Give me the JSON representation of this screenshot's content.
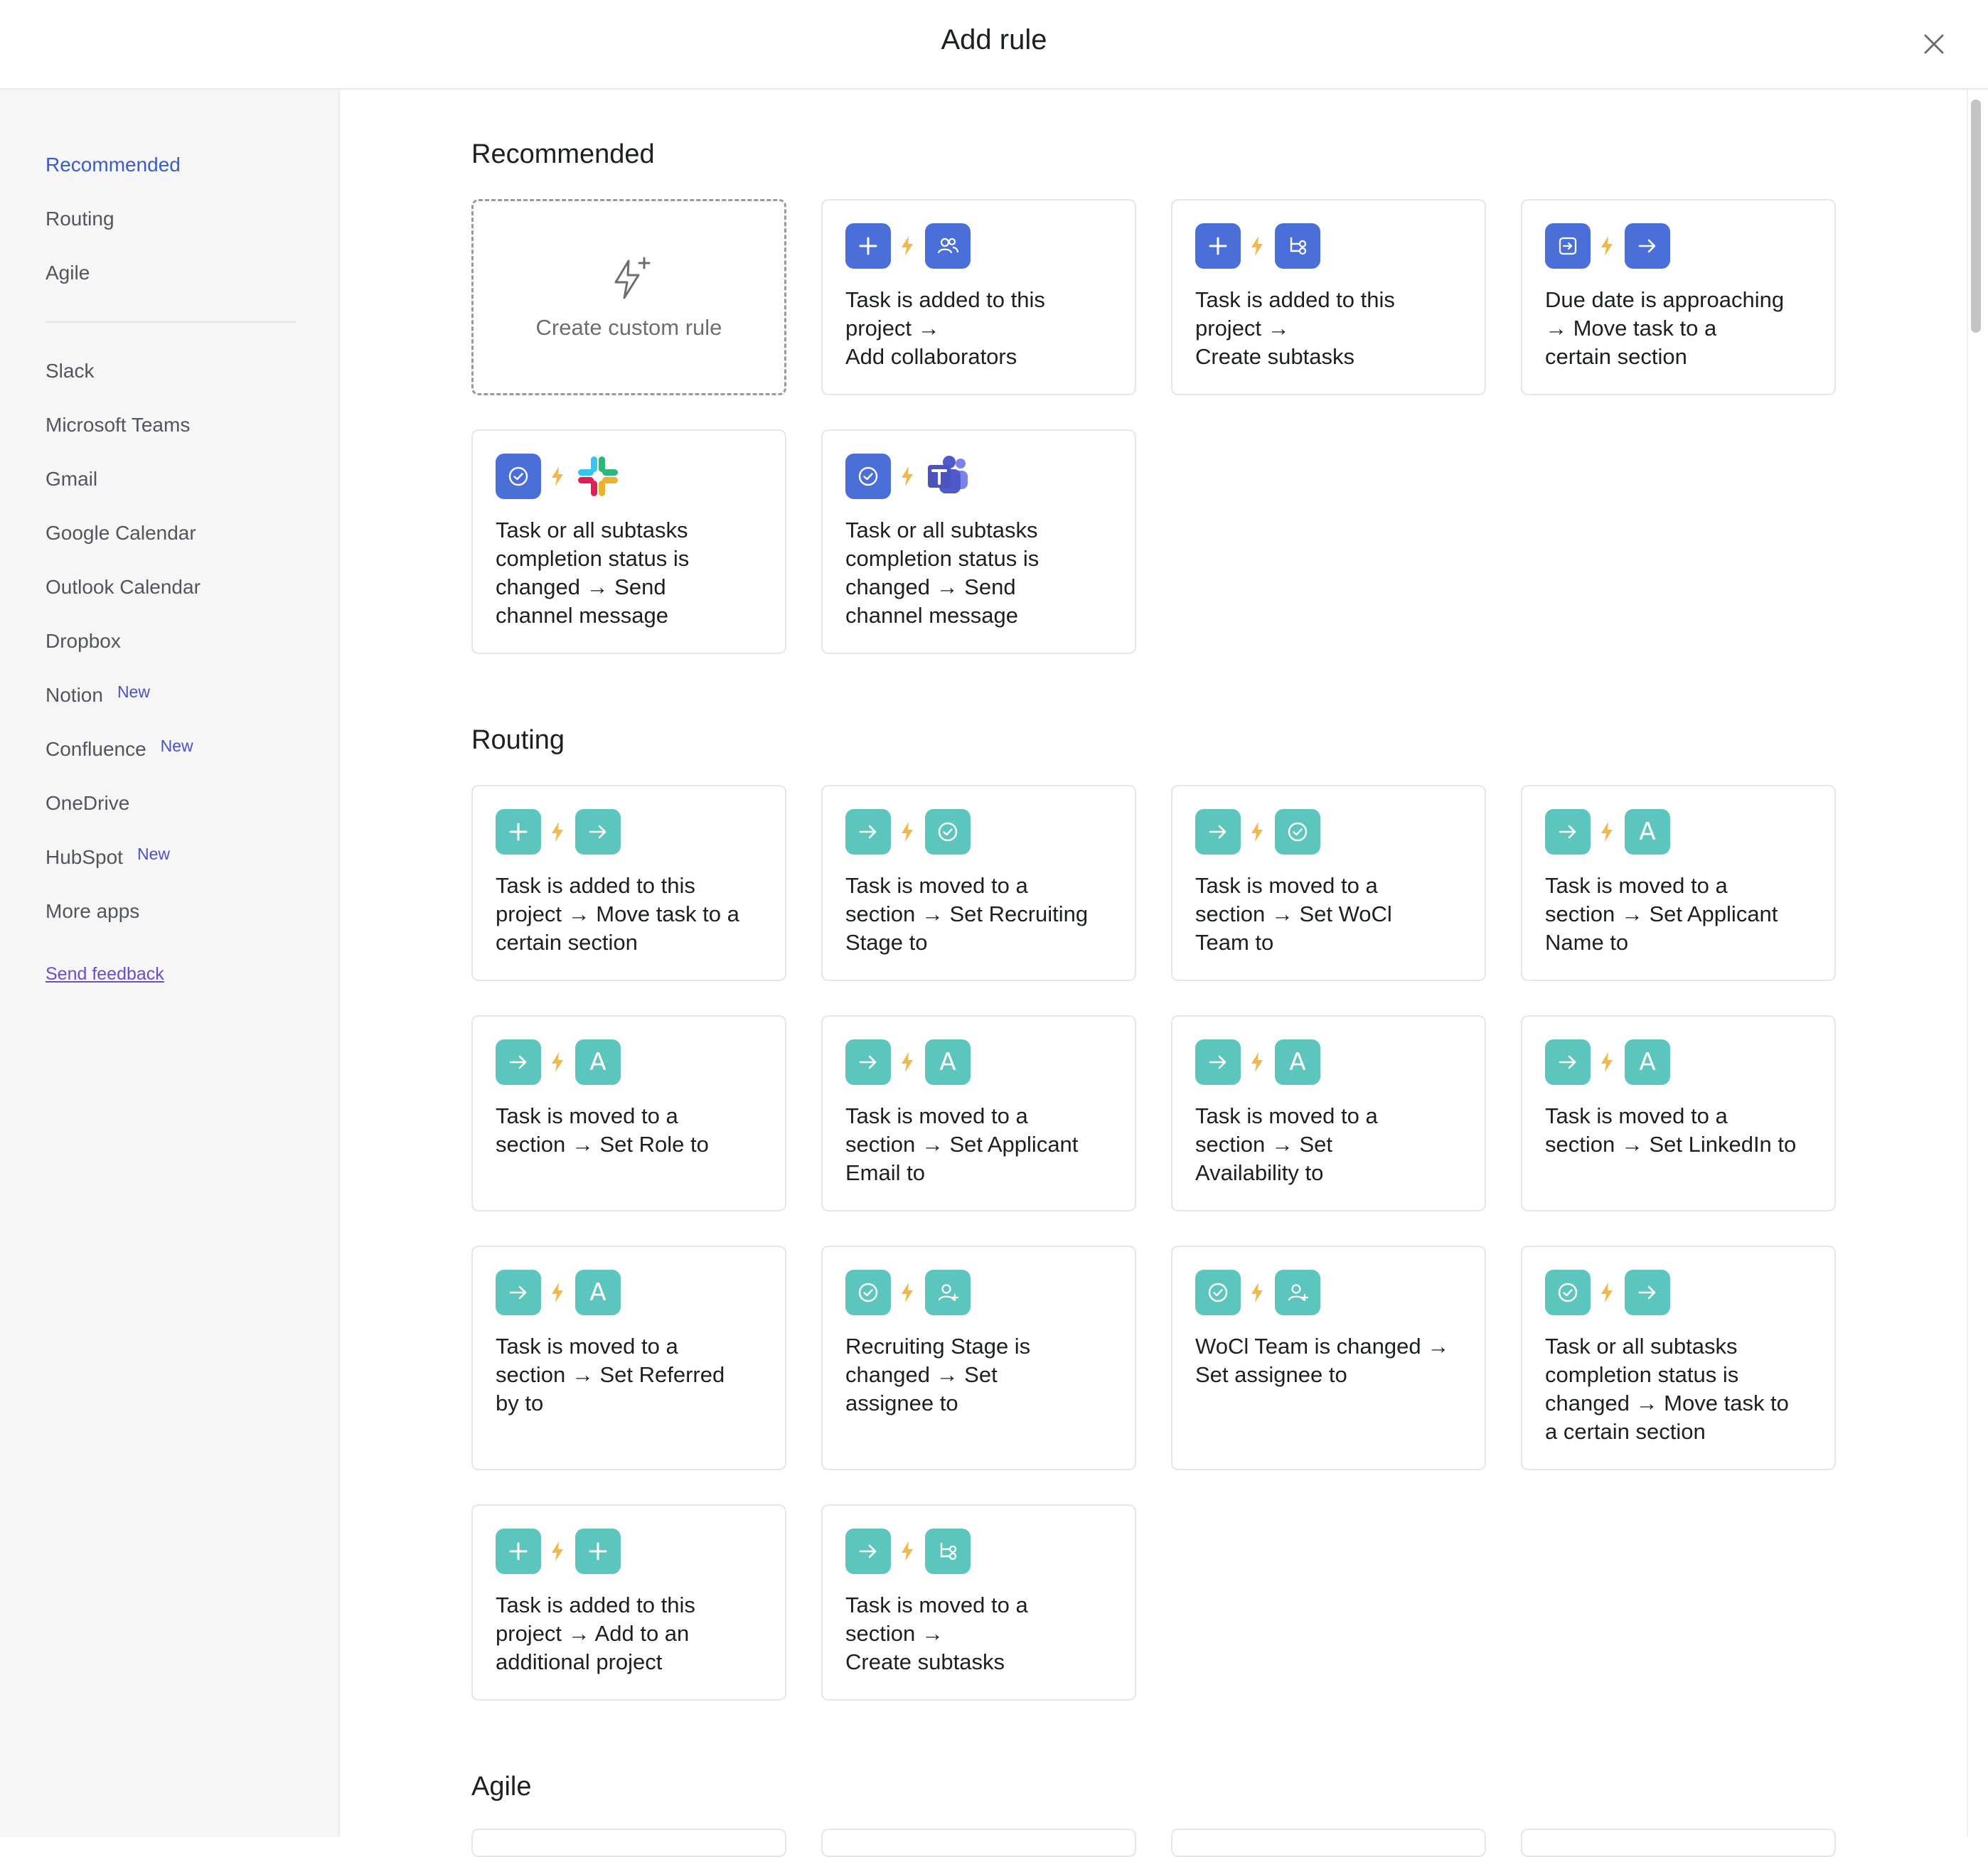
{
  "header": {
    "title": "Add rule"
  },
  "sidebar": {
    "items": [
      {
        "label": "Recommended",
        "badge": ""
      },
      {
        "label": "Routing",
        "badge": ""
      },
      {
        "label": "Agile",
        "badge": ""
      },
      {
        "label": "Slack",
        "badge": ""
      },
      {
        "label": "Microsoft Teams",
        "badge": ""
      },
      {
        "label": "Gmail",
        "badge": ""
      },
      {
        "label": "Google Calendar",
        "badge": ""
      },
      {
        "label": "Outlook Calendar",
        "badge": ""
      },
      {
        "label": "Dropbox",
        "badge": ""
      },
      {
        "label": "Notion",
        "badge": "New"
      },
      {
        "label": "Confluence",
        "badge": "New"
      },
      {
        "label": "OneDrive",
        "badge": ""
      },
      {
        "label": "HubSpot",
        "badge": "New"
      },
      {
        "label": "More apps",
        "badge": ""
      }
    ],
    "feedback": "Send feedback"
  },
  "sections": {
    "recommended": {
      "title": "Recommended",
      "custom_rule": "Create custom rule",
      "cards": [
        {
          "line1": "Task is added to this",
          "line2": "project →",
          "line3": "Add collaborators",
          "line4": ""
        },
        {
          "line1": "Task is added to this",
          "line2": "project →",
          "line3": "Create subtasks",
          "line4": ""
        },
        {
          "line1": "Due date is approaching",
          "line2": "→ Move task to a",
          "line3": "certain section",
          "line4": ""
        },
        {
          "line1": "Task or all subtasks",
          "line2": "completion status is",
          "line3": "changed → Send",
          "line4": "channel message"
        },
        {
          "line1": "Task or all subtasks",
          "line2": "completion status is",
          "line3": "changed → Send",
          "line4": "channel message"
        }
      ]
    },
    "routing": {
      "title": "Routing",
      "cards": [
        {
          "line1": "Task is added to this",
          "line2": "project → Move task to a",
          "line3": "certain section",
          "line4": ""
        },
        {
          "line1": "Task is moved to a",
          "line2": "section → Set Recruiting",
          "line3": "Stage to",
          "line4": ""
        },
        {
          "line1": "Task is moved to a",
          "line2": "section → Set WoCl",
          "line3": "Team to",
          "line4": ""
        },
        {
          "line1": "Task is moved to a",
          "line2": "section → Set Applicant",
          "line3": "Name to",
          "line4": ""
        },
        {
          "line1": "Task is moved to a",
          "line2": "section → Set Role to",
          "line3": "",
          "line4": ""
        },
        {
          "line1": "Task is moved to a",
          "line2": "section → Set Applicant",
          "line3": "Email to",
          "line4": ""
        },
        {
          "line1": "Task is moved to a",
          "line2": "section → Set",
          "line3": "Availability to",
          "line4": ""
        },
        {
          "line1": "Task is moved to a",
          "line2": "section → Set LinkedIn to",
          "line3": "",
          "line4": ""
        },
        {
          "line1": "Task is moved to a",
          "line2": "section → Set Referred",
          "line3": "by to",
          "line4": ""
        },
        {
          "line1": "Recruiting Stage is",
          "line2": "changed → Set",
          "line3": "assignee to",
          "line4": ""
        },
        {
          "line1": "WoCl Team is changed →",
          "line2": "Set assignee to",
          "line3": "",
          "line4": ""
        },
        {
          "line1": "Task or all subtasks",
          "line2": "completion status is",
          "line3": "changed → Move task to",
          "line4": "a certain section"
        },
        {
          "line1": "Task is added to this",
          "line2": "project → Add to an",
          "line3": "additional project",
          "line4": ""
        },
        {
          "line1": "Task is moved to a",
          "line2": "section →",
          "line3": "Create subtasks",
          "line4": ""
        }
      ]
    },
    "agile": {
      "title": "Agile"
    }
  },
  "icons": {
    "close": "close-icon",
    "custom": "sparkle-bolt-icon",
    "bolt": "bolt-icon",
    "colors": {
      "blue": "#4b6fd8",
      "teal": "#5cc6be",
      "bolt": "#f3b84b",
      "accent": "#3b5bc5"
    }
  }
}
